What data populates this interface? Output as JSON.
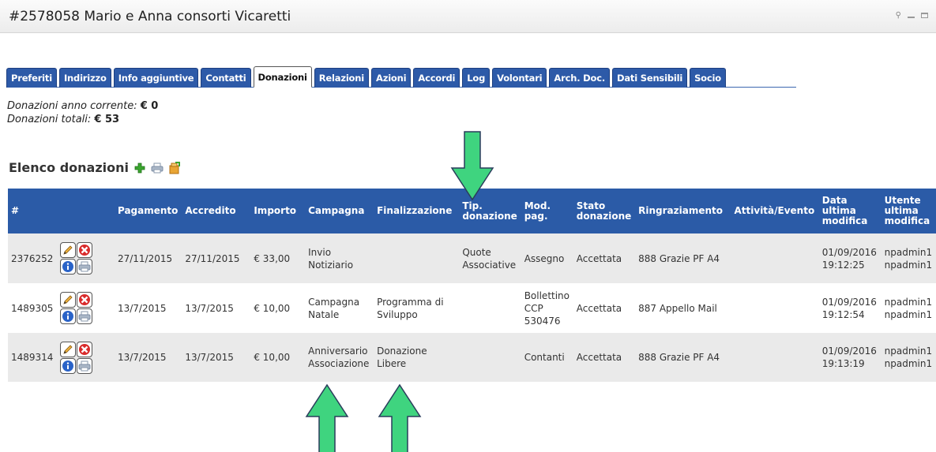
{
  "window": {
    "title": "#2578058 Mario e Anna consorti Vicaretti"
  },
  "tabs": [
    {
      "label": "Preferiti",
      "active": false
    },
    {
      "label": "Indirizzo",
      "active": false
    },
    {
      "label": "Info aggiuntive",
      "active": false
    },
    {
      "label": "Contatti",
      "active": false
    },
    {
      "label": "Donazioni",
      "active": true
    },
    {
      "label": "Relazioni",
      "active": false
    },
    {
      "label": "Azioni",
      "active": false
    },
    {
      "label": "Accordi",
      "active": false
    },
    {
      "label": "Log",
      "active": false
    },
    {
      "label": "Volontari",
      "active": false
    },
    {
      "label": "Arch. Doc.",
      "active": false
    },
    {
      "label": "Dati Sensibili",
      "active": false
    },
    {
      "label": "Socio",
      "active": false
    }
  ],
  "summary": {
    "current_year_label": "Donazioni anno corrente:",
    "current_year_value": "€ 0",
    "total_label": "Donazioni totali:",
    "total_value": "€ 53"
  },
  "list": {
    "title": "Elenco donazioni",
    "icons": [
      "add-icon",
      "print-icon",
      "export-icon"
    ]
  },
  "table": {
    "headers": [
      [
        "#"
      ],
      [
        ""
      ],
      [
        "Pagamento"
      ],
      [
        "Accredito"
      ],
      [
        "Importo"
      ],
      [
        "Campagna"
      ],
      [
        "Finalizzazione"
      ],
      [
        "Tip.",
        "donazione"
      ],
      [
        "Mod.",
        "pag."
      ],
      [
        "Stato",
        "donazione"
      ],
      [
        "Ringraziamento"
      ],
      [
        "Attività/Evento"
      ],
      [
        "Data",
        "ultima",
        "modifica"
      ],
      [
        "Utente",
        "ultima",
        "modifica"
      ]
    ],
    "rows": [
      {
        "id": "2376252",
        "pagamento": "27/11/2015",
        "accredito": "27/11/2015",
        "importo": "€ 33,00",
        "campagna": [
          "Invio",
          "Notiziario"
        ],
        "finalizzazione": [],
        "tipo": [
          "Quote",
          "Associative"
        ],
        "mod_pag": [
          "Assegno"
        ],
        "stato": "Accettata",
        "ringraziamento": "888 Grazie PF A4",
        "attivita": "",
        "data_modifica": [
          "01/09/2016",
          "19:12:25"
        ],
        "utente": [
          "npadmin1",
          "npadmin1"
        ]
      },
      {
        "id": "1489305",
        "pagamento": "13/7/2015",
        "accredito": "13/7/2015",
        "importo": "€ 10,00",
        "campagna": [
          "Campagna",
          "Natale"
        ],
        "finalizzazione": [
          "Programma di",
          "Sviluppo"
        ],
        "tipo": [],
        "mod_pag": [
          "Bollettino",
          "CCP",
          "530476"
        ],
        "stato": "Accettata",
        "ringraziamento": "887 Appello Mail",
        "attivita": "",
        "data_modifica": [
          "01/09/2016",
          "19:12:54"
        ],
        "utente": [
          "npadmin1",
          "npadmin1"
        ]
      },
      {
        "id": "1489314",
        "pagamento": "13/7/2015",
        "accredito": "13/7/2015",
        "importo": "€ 10,00",
        "campagna": [
          "Anniversario",
          "Associazione"
        ],
        "finalizzazione": [
          "Donazione",
          "Libere"
        ],
        "tipo": [],
        "mod_pag": [
          "Contanti"
        ],
        "stato": "Accettata",
        "ringraziamento": "888 Grazie PF A4",
        "attivita": "",
        "data_modifica": [
          "01/09/2016",
          "19:13:19"
        ],
        "utente": [
          "npadmin1",
          "npadmin1"
        ]
      }
    ],
    "row_actions": [
      "edit-icon",
      "delete-icon",
      "info-icon",
      "print-icon"
    ]
  },
  "colors": {
    "header_bg": "#2b5ba7",
    "tab_bg": "#2d5aa8",
    "row_alt_bg": "#eaeaea",
    "arrow_fill": "#3fd47f",
    "arrow_stroke": "#2a3d5c"
  }
}
